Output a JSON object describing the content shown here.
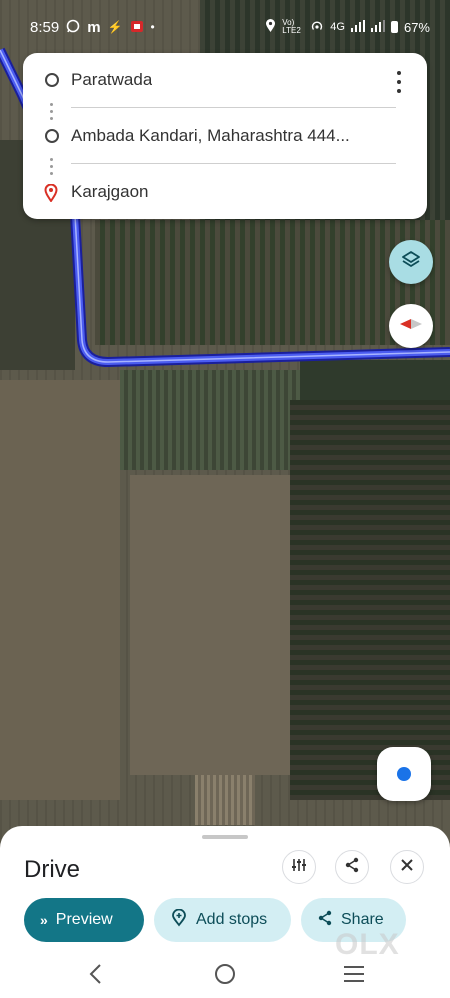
{
  "status_bar": {
    "time": "8:59",
    "left_icons": [
      "whatsapp-icon",
      "m-app-icon",
      "lightning-icon",
      "shop-icon",
      "dot-icon"
    ],
    "right_icons": [
      "location-icon",
      "volte-icon",
      "hotspot-icon",
      "signal-icon",
      "battery-icon"
    ],
    "network_label": "4G",
    "volte_label": "Vo) LTE2",
    "battery": "67%"
  },
  "directions": {
    "stops": [
      {
        "label": "Paratwada",
        "icon": "circle-icon"
      },
      {
        "label": "Ambada Kandari, Maharashtra 444...",
        "icon": "circle-icon"
      },
      {
        "label": "Karajgaon",
        "icon": "pin-icon"
      }
    ],
    "menu_icon": "more-vert-icon"
  },
  "map": {
    "layers_icon": "layers-icon",
    "compass_icon": "compass-icon",
    "location_icon": "my-location-icon",
    "route_color": "#2b2fd9"
  },
  "sheet": {
    "title": "Drive",
    "options_icon": "tune-icon",
    "share_icon": "share-icon",
    "close_icon": "close-icon",
    "buttons": {
      "preview": "Preview",
      "add_stops": "Add stops",
      "share": "Share"
    }
  },
  "colors": {
    "accent": "#137687",
    "chip_bg": "#d3eef3",
    "pin": "#d93025"
  },
  "watermark": "OLX",
  "nav": [
    "back-icon",
    "home-icon",
    "recents-icon"
  ]
}
